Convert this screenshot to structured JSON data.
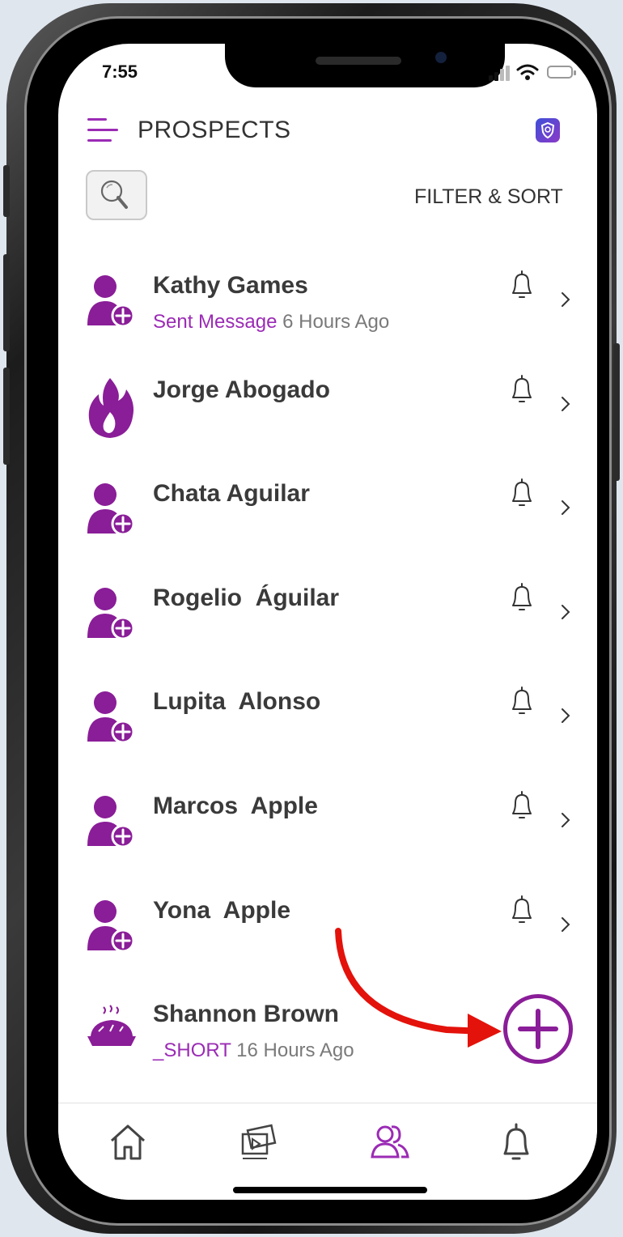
{
  "status_bar": {
    "time": "7:55"
  },
  "header": {
    "title": "PROSPECTS",
    "filter_sort_label": "FILTER & SORT"
  },
  "prospects": [
    {
      "name": "Kathy Games",
      "icon": "add-person-icon",
      "sub_tag": "Sent Message",
      "sub_time": "6 Hours Ago"
    },
    {
      "name": "Jorge Abogado",
      "icon": "fire-icon",
      "sub_tag": "",
      "sub_time": ""
    },
    {
      "name": "Chata Aguilar",
      "icon": "add-person-icon",
      "sub_tag": "",
      "sub_time": ""
    },
    {
      "name": "Rogelio  Águilar",
      "icon": "add-person-icon",
      "sub_tag": "",
      "sub_time": ""
    },
    {
      "name": "Lupita  Alonso",
      "icon": "add-person-icon",
      "sub_tag": "",
      "sub_time": ""
    },
    {
      "name": "Marcos  Apple",
      "icon": "add-person-icon",
      "sub_tag": "",
      "sub_time": ""
    },
    {
      "name": "Yona  Apple",
      "icon": "add-person-icon",
      "sub_tag": "",
      "sub_time": ""
    },
    {
      "name": "Shannon Brown",
      "icon": "pie-icon",
      "sub_tag": "_SHORT",
      "sub_time": "16 Hours Ago"
    }
  ],
  "fab": {
    "icon": "plus-icon"
  },
  "annotation": {
    "icon": "red-arrow-icon",
    "color": "#e3120b"
  },
  "tab_bar": {
    "items": [
      {
        "icon": "home-icon",
        "active": false
      },
      {
        "icon": "media-icon",
        "active": false
      },
      {
        "icon": "people-icon",
        "active": true
      },
      {
        "icon": "bell-icon",
        "active": false
      }
    ]
  },
  "colors": {
    "accent": "#9b2bb5",
    "fab_border": "#8a1d98",
    "text": "#3a3a3a",
    "muted": "#7a7a7a"
  }
}
